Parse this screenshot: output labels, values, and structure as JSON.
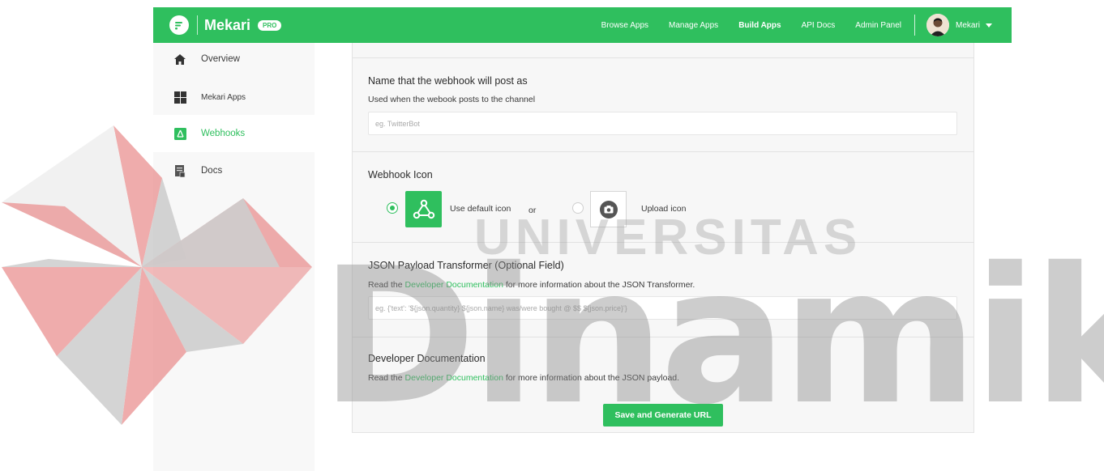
{
  "header": {
    "brand_name": "Mekari",
    "brand_badge": "PRO",
    "nav": [
      "Browse Apps",
      "Manage Apps",
      "Build Apps",
      "API Docs",
      "Admin Panel"
    ],
    "active_nav": "Build Apps",
    "user_name": "Mekari",
    "accent_color": "#2fbf5e"
  },
  "sidebar": {
    "items": [
      {
        "label": "Overview",
        "icon": "home-icon"
      },
      {
        "label": "Mekari Apps",
        "icon": "grid-icon"
      },
      {
        "label": "Webhooks",
        "icon": "webhook-icon",
        "active": true
      },
      {
        "label": "Docs",
        "icon": "document-icon"
      }
    ]
  },
  "form": {
    "name_section": {
      "title": "Name that the webhook will post as",
      "description": "Used when the webook posts to the channel",
      "placeholder": "eg. TwitterBot",
      "value": ""
    },
    "icon_section": {
      "title": "Webhook Icon",
      "default_label": "Use default icon",
      "or_label": "or",
      "upload_label": "Upload icon",
      "selected": "default"
    },
    "json_section": {
      "title": "JSON Payload Transformer (Optional Field)",
      "desc_prefix": "Read the",
      "desc_link": "Developer Documentation",
      "desc_suffix": "for more information about the JSON Transformer.",
      "placeholder": "eg. {'text': '${json.quantity} ${json.name} was/were bought @ $$ ${json.price}'}",
      "value": ""
    },
    "docs_section": {
      "title": "Developer Documentation",
      "desc_prefix": "Read the",
      "desc_link": "Developer Documentation",
      "desc_suffix": "for more information about the JSON payload."
    },
    "submit_label": "Save and Generate URL"
  },
  "watermark": {
    "upper": "UNIVERSITAS",
    "lower": "Dinamika"
  }
}
